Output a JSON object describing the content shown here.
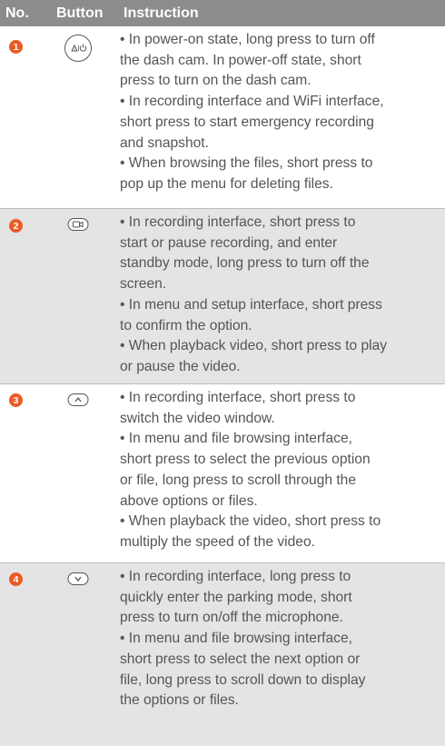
{
  "header": {
    "no": "No.",
    "button": "Button",
    "instruction": "Instruction"
  },
  "colors": {
    "header_bg": "#8c8c8c",
    "badge": "#ea5b25",
    "row_shade": "#e4e4e4",
    "text": "#555555"
  },
  "rows": [
    {
      "no": "1",
      "icon": "power-emergency-icon",
      "lines": [
        "• In power-on state, long press to turn off",
        "the dash cam. In power-off state, short",
        "press to turn on the dash cam.",
        "• In recording interface and WiFi interface,",
        "short press to start emergency recording",
        "and snapshot.",
        "• When browsing the files, short press to",
        "pop up the menu for deleting files."
      ]
    },
    {
      "no": "2",
      "icon": "record-button-icon",
      "lines": [
        "• In recording interface, short press to",
        "start or pause recording, and enter",
        "standby mode, long press to turn off the",
        "screen.",
        "• In menu and setup interface, short press",
        "to confirm the option.",
        "• When playback video, short press to play",
        "or pause the video."
      ]
    },
    {
      "no": "3",
      "icon": "up-button-icon",
      "lines": [
        "• In recording interface, short press to",
        "switch the video window.",
        "• In menu and file browsing interface,",
        "short press to select the previous option",
        "or file, long press to scroll through the",
        "above options or files.",
        "• When playback the video, short press to",
        "multiply the speed of the video."
      ]
    },
    {
      "no": "4",
      "icon": "down-button-icon",
      "lines": [
        "• In recording interface, long press to",
        "quickly enter the parking mode, short",
        "press to turn on/off the microphone.",
        "• In menu and file browsing interface,",
        "short press to select the next option or",
        "file, long press to scroll down to display",
        "the options or files."
      ]
    }
  ]
}
